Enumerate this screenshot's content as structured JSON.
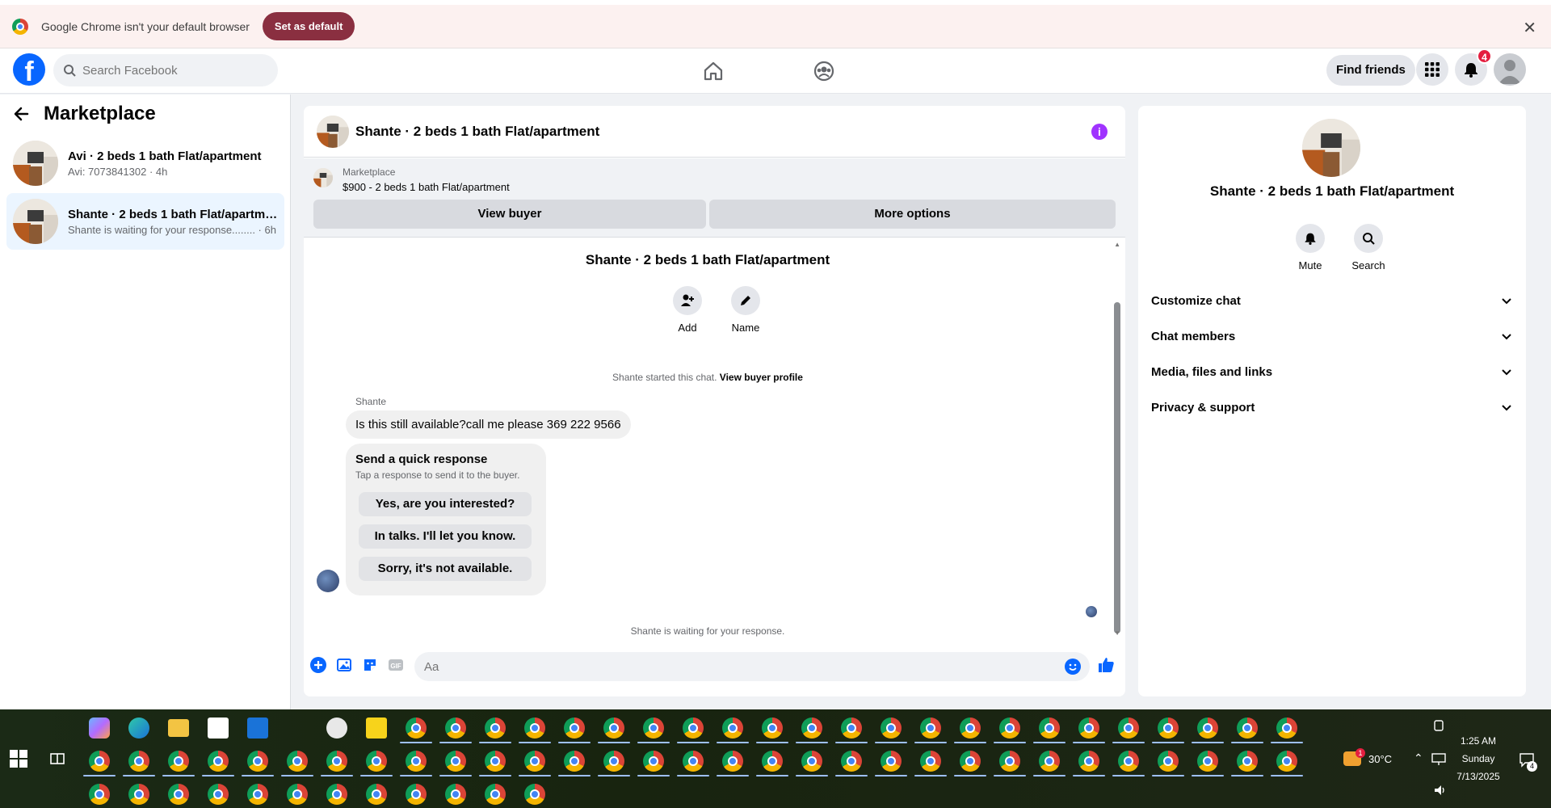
{
  "chrome_banner": {
    "message": "Google Chrome isn't your default browser",
    "set_default_label": "Set as default",
    "close_glyph": "✕"
  },
  "header": {
    "logo_glyph": "f",
    "search_placeholder": "Search Facebook",
    "find_friends_label": "Find friends",
    "notification_count": "4"
  },
  "sidebar": {
    "title": "Marketplace",
    "conversations": [
      {
        "title": "Avi · 2 beds 1 bath Flat/apartment",
        "subtitle": "Avi: 7073841302 · 4h",
        "active": false
      },
      {
        "title": "Shante · 2 beds 1 bath Flat/apartment",
        "subtitle": "Shante is waiting for your response........ · 6h",
        "active": true
      }
    ]
  },
  "chat": {
    "title": "Shante · 2 beds 1 bath Flat/apartment",
    "info_glyph": "i",
    "listing": {
      "label": "Marketplace",
      "price_title": "$900 - 2 beds 1 bath Flat/apartment",
      "view_buyer_label": "View buyer",
      "more_options_label": "More options"
    },
    "center_name": "Shante · 2 beds 1 bath Flat/apartment",
    "actions": [
      {
        "label": "Add"
      },
      {
        "label": "Name"
      }
    ],
    "started_text": "Shante started this chat. ",
    "view_profile_link": "View buyer profile",
    "sender_name": "Shante",
    "message": "Is this still available?call me please 369 222 9566",
    "quick_response": {
      "title": "Send a quick response",
      "subtitle": "Tap a response to send it to the buyer.",
      "options": [
        "Yes, are you interested?",
        "In talks. I'll let you know.",
        "Sorry, it's not available."
      ]
    },
    "waiting_text": "Shante is waiting for your response.",
    "composer_placeholder": "Aa"
  },
  "right_panel": {
    "name": "Shante · 2 beds 1 bath Flat/apartment",
    "actions": [
      {
        "label": "Mute"
      },
      {
        "label": "Search"
      }
    ],
    "sections": [
      "Customize chat",
      "Chat members",
      "Media, files and links",
      "Privacy & support"
    ]
  },
  "taskbar": {
    "temperature": "30°C",
    "weather_badge": "1",
    "time": "1:25 AM",
    "day": "Sunday",
    "date": "7/13/2025",
    "notif_count": "4"
  },
  "colors": {
    "fb_blue": "#0866ff",
    "chrome_banner_btn": "#8a2f40",
    "info_purple": "#a033ff",
    "badge_red": "#e41e3f"
  }
}
